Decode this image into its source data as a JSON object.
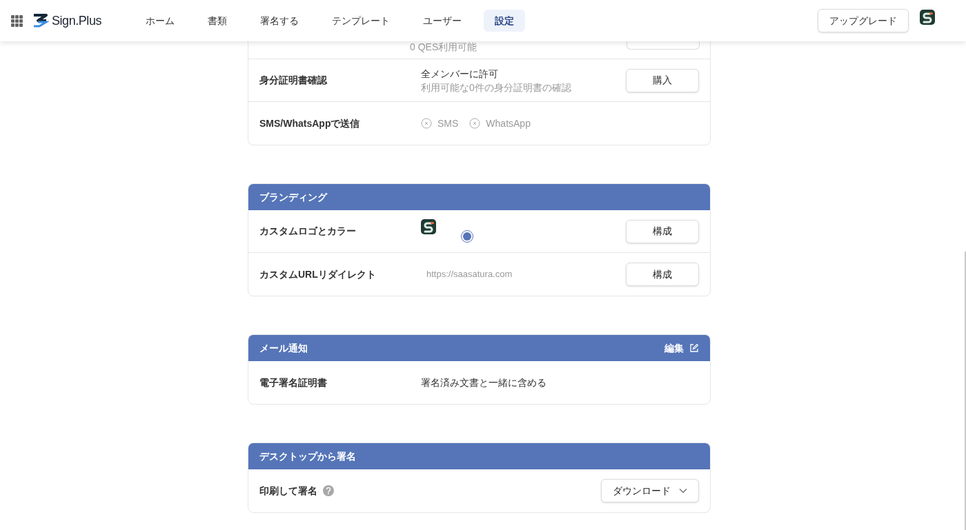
{
  "nav": {
    "brand": "Sign.Plus",
    "tabs": [
      {
        "label": "ホーム",
        "selected": false
      },
      {
        "label": "書類",
        "selected": false
      },
      {
        "label": "署名する",
        "selected": false
      },
      {
        "label": "テンプレート",
        "selected": false
      },
      {
        "label": "ユーザー",
        "selected": false
      },
      {
        "label": "設定",
        "selected": true
      }
    ],
    "upgrade": "アップグレード"
  },
  "sections": [
    {
      "rows": [
        {
          "kind": "partial",
          "secondary": "0 QES利用可能"
        },
        {
          "kind": "info",
          "label": "身分証明書確認",
          "primary": "全メンバーに許可",
          "secondary": "利用可能な0件の身分証明書の確認",
          "button": "購入"
        },
        {
          "kind": "options",
          "label": "SMS/WhatsAppで送信",
          "options": [
            {
              "label": "SMS",
              "checked": false
            },
            {
              "label": "WhatsApp",
              "checked": false
            }
          ]
        }
      ]
    },
    {
      "title": "ブランディング",
      "rows": [
        {
          "kind": "logo_color",
          "label": "カスタムロゴとカラー",
          "selected": true,
          "button": "構成"
        },
        {
          "kind": "url",
          "label": "カスタムURLリダイレクト",
          "secondary": "https://saasatura.com",
          "button": "構成"
        }
      ]
    },
    {
      "title": "メール通知",
      "action": "編集",
      "rows": [
        {
          "kind": "info",
          "label": "電子署名証明書",
          "primary": "署名済み文書と一緒に含める"
        }
      ]
    },
    {
      "title": "デスクトップから署名",
      "rows": [
        {
          "kind": "dropdown",
          "label": "印刷して署名",
          "help": true,
          "dropdown": "ダウンロード"
        }
      ]
    }
  ]
}
